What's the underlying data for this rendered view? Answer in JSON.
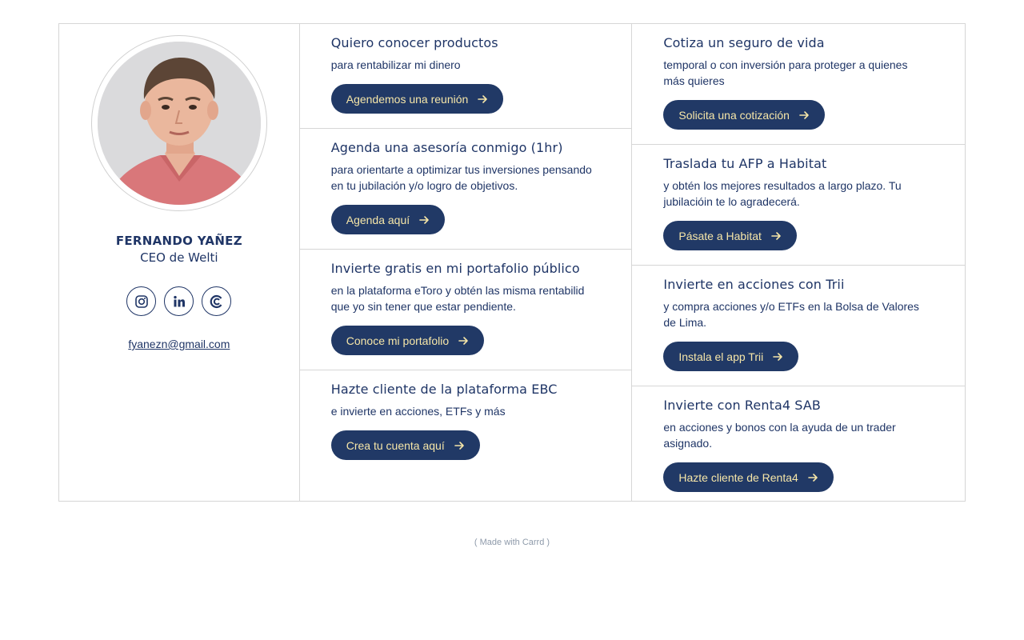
{
  "profile": {
    "name": "FERNANDO YAÑEZ",
    "role": "CEO de Welti",
    "email": "fyanezn@gmail.com",
    "socials": [
      {
        "icon": "instagram-icon"
      },
      {
        "icon": "linkedin-icon"
      },
      {
        "icon": "coinbase-icon"
      }
    ]
  },
  "middle": [
    {
      "title": "Quiero conocer productos",
      "desc": "para rentabilizar mi dinero",
      "button": "Agendemos una reunión"
    },
    {
      "title": "Agenda una asesoría conmigo (1hr)",
      "desc": "para orientarte a optimizar tus inversiones pensando en tu jubilación y/o logro de objetivos.",
      "button": "Agenda aquí"
    },
    {
      "title": "Invierte gratis en mi portafolio público",
      "desc": "en la plataforma eToro y obtén las misma rentabilid que yo sin tener que estar pendiente.",
      "button": "Conoce mi portafolio"
    },
    {
      "title": "Hazte cliente de la plataforma EBC",
      "desc": "e invierte en acciones, ETFs y más",
      "button": "Crea tu cuenta aquí"
    }
  ],
  "right": [
    {
      "title": "Cotiza un seguro de vida",
      "desc": "temporal o con inversión para proteger a quienes más quieres",
      "button": "Solicita una cotización"
    },
    {
      "title": "Traslada tu AFP a Habitat",
      "desc": "y obtén los mejores resultados a largo plazo. Tu jubilacióin te lo agradecerá.",
      "button": "Pásate a Habitat"
    },
    {
      "title": "Invierte en acciones con Trii",
      "desc": "y compra acciones y/o ETFs en la Bolsa de Valores de Lima.",
      "button": "Instala el app Trii"
    },
    {
      "title": "Invierte con Renta4 SAB",
      "desc": "en acciones y bonos con la ayuda de un trader asignado.",
      "button": "Hazte cliente de Renta4"
    }
  ],
  "footer": "( Made with Carrd )",
  "colors": {
    "navy": "#213966",
    "button_text": "#f6e6a8",
    "border": "#d6d6d6"
  }
}
